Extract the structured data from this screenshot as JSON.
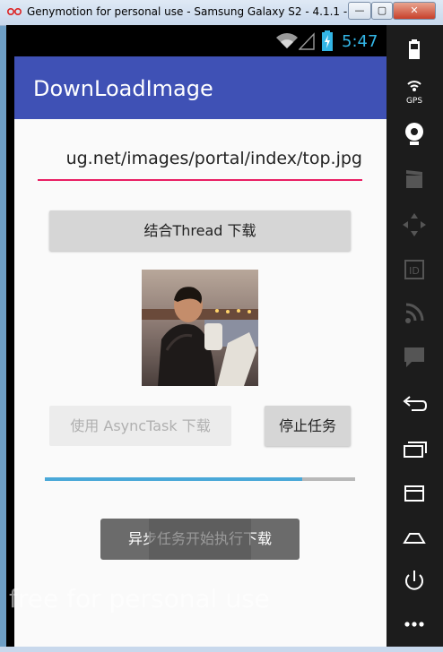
{
  "window": {
    "title": "Genymotion for personal use - Samsung Galaxy S2 - 4.1.1 - ...",
    "min_label": "—",
    "max_label": "▢",
    "close_label": "✕"
  },
  "statusbar": {
    "time": "5:47"
  },
  "app": {
    "title": "DownLoadImage",
    "url_value": "ug.net/images/portal/index/top.jpg",
    "thread_button": "结合Thread 下载",
    "async_button": "使用 AsyncTask 下载",
    "stop_button": "停止任务",
    "progress": 0.83,
    "toast": "异步任务开始执行下载"
  },
  "watermark": "free for personal use",
  "sidebar": {
    "gps_label": "GPS",
    "icons": [
      "battery-icon",
      "gps-icon",
      "camera-icon",
      "media-icon",
      "dpad-icon",
      "id-icon",
      "rss-icon",
      "sms-icon",
      "back-icon",
      "recent-apps-icon",
      "menu-icon",
      "home-icon",
      "power-icon",
      "more-icon"
    ]
  },
  "colors": {
    "accent": "#3f51b5",
    "underline": "#e91e63",
    "progress": "#4aa8d8",
    "status_time": "#33b5e5"
  }
}
